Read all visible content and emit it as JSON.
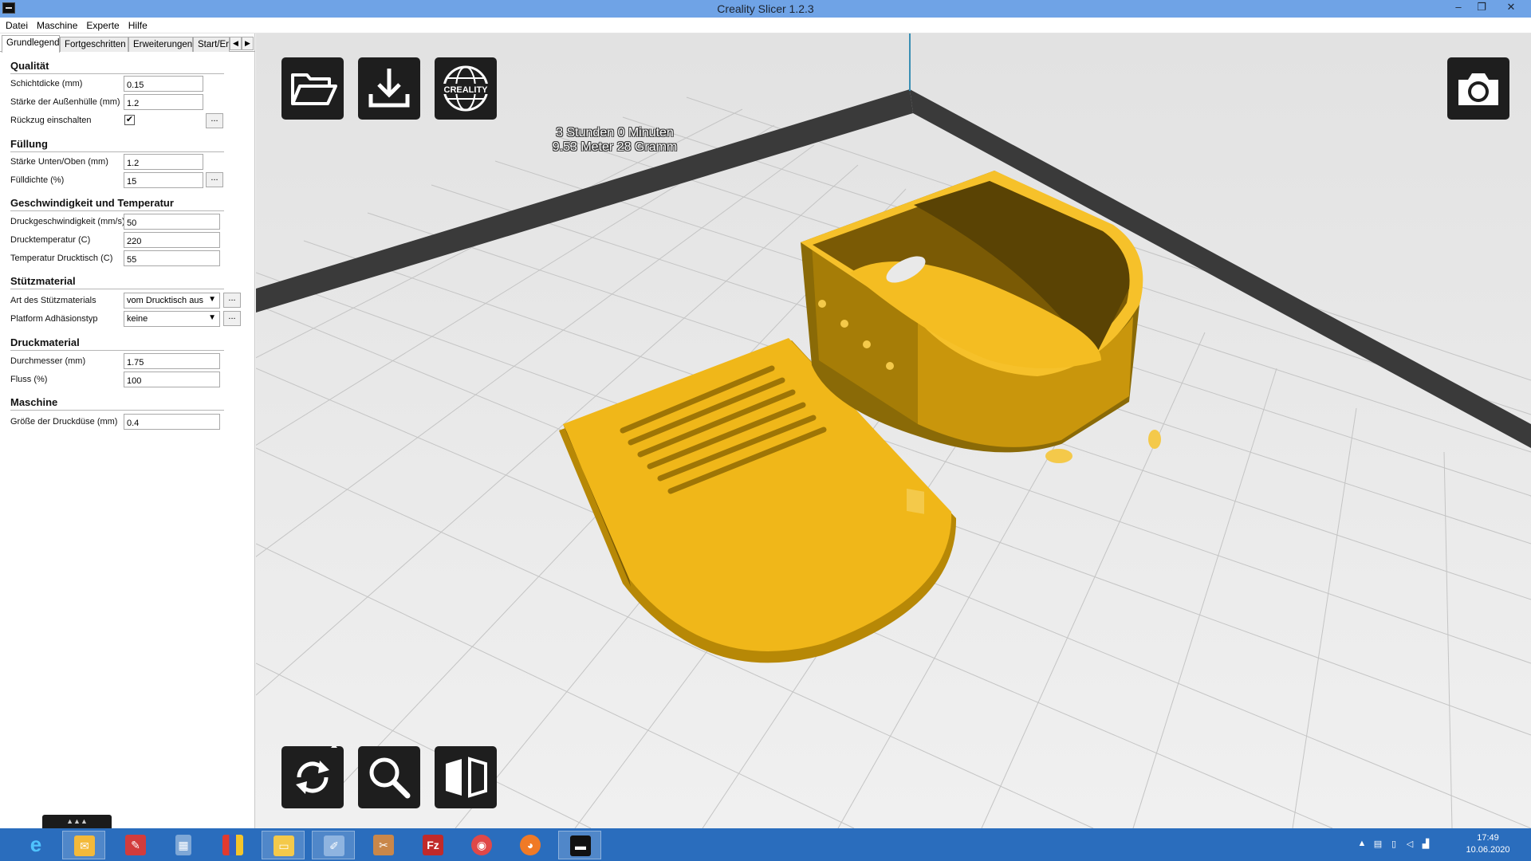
{
  "window": {
    "title": "Creality Slicer 1.2.3",
    "minimize": "–",
    "restore": "❐",
    "close": "✕"
  },
  "menu": [
    "Datei",
    "Maschine",
    "Experte",
    "Hilfe"
  ],
  "tabs": [
    "Grundlegend",
    "Fortgeschritten",
    "Erweiterungen",
    "Start/Er"
  ],
  "sections": {
    "quality": "Qualität",
    "fill": "Füllung",
    "speed": "Geschwindigkeit und Temperatur",
    "support": "Stützmaterial",
    "filament": "Druckmaterial",
    "machine": "Maschine"
  },
  "fields": {
    "layer_height": {
      "label": "Schichtdicke (mm)",
      "value": "0.15"
    },
    "shell_thickness": {
      "label": "Stärke der Außenhülle (mm)",
      "value": "1.2"
    },
    "retraction": {
      "label": "Rückzug einschalten",
      "checked": "✔"
    },
    "bottom_top_thickness": {
      "label": "Stärke Unten/Oben (mm)",
      "value": "1.2"
    },
    "fill_density": {
      "label": "Fülldichte (%)",
      "value": "15"
    },
    "print_speed": {
      "label": "Druckgeschwindigkeit (mm/s)",
      "value": "50"
    },
    "print_temp": {
      "label": "Drucktemperatur (C)",
      "value": "220"
    },
    "bed_temp": {
      "label": "Temperatur Drucktisch (C)",
      "value": "55"
    },
    "support_type": {
      "label": "Art des Stützmaterials",
      "value": "vom Drucktisch aus"
    },
    "adhesion_type": {
      "label": "Platform Adhäsionstyp",
      "value": "keine"
    },
    "diameter": {
      "label": "Durchmesser (mm)",
      "value": "1.75"
    },
    "flow": {
      "label": "Fluss (%)",
      "value": "100"
    },
    "nozzle_size": {
      "label": "Größe der Druckdüse (mm)",
      "value": "0.4"
    }
  },
  "dots_label": "...",
  "print_info": {
    "time": "3 Stunden 0 Minuten",
    "material": "9.53 Meter 28 Gramm"
  },
  "toolbar_icons": [
    "folder-open-icon",
    "download-icon",
    "creality-logo-icon",
    "camera-icon",
    "rotate-icon",
    "scale-icon",
    "mirror-icon"
  ],
  "creality_logo_text": "CREALITY",
  "taskbar": {
    "apps": [
      "internet-explorer",
      "outlook",
      "pdf-app",
      "calculator",
      "office-app",
      "file-explorer",
      "paint-app",
      "tool-app",
      "filezilla",
      "disk-app",
      "firefox",
      "creality-slicer"
    ],
    "filezilla_glyph": "Fz",
    "tray_up": "▲",
    "time": "17:49",
    "date": "10.06.2020"
  },
  "colors": {
    "model_yellow": "#f0b719",
    "model_dark": "#8a6a07",
    "bed": "#e9e9e9",
    "taskbar": "#2a6dbd",
    "titlebar": "#6fa3e6"
  }
}
